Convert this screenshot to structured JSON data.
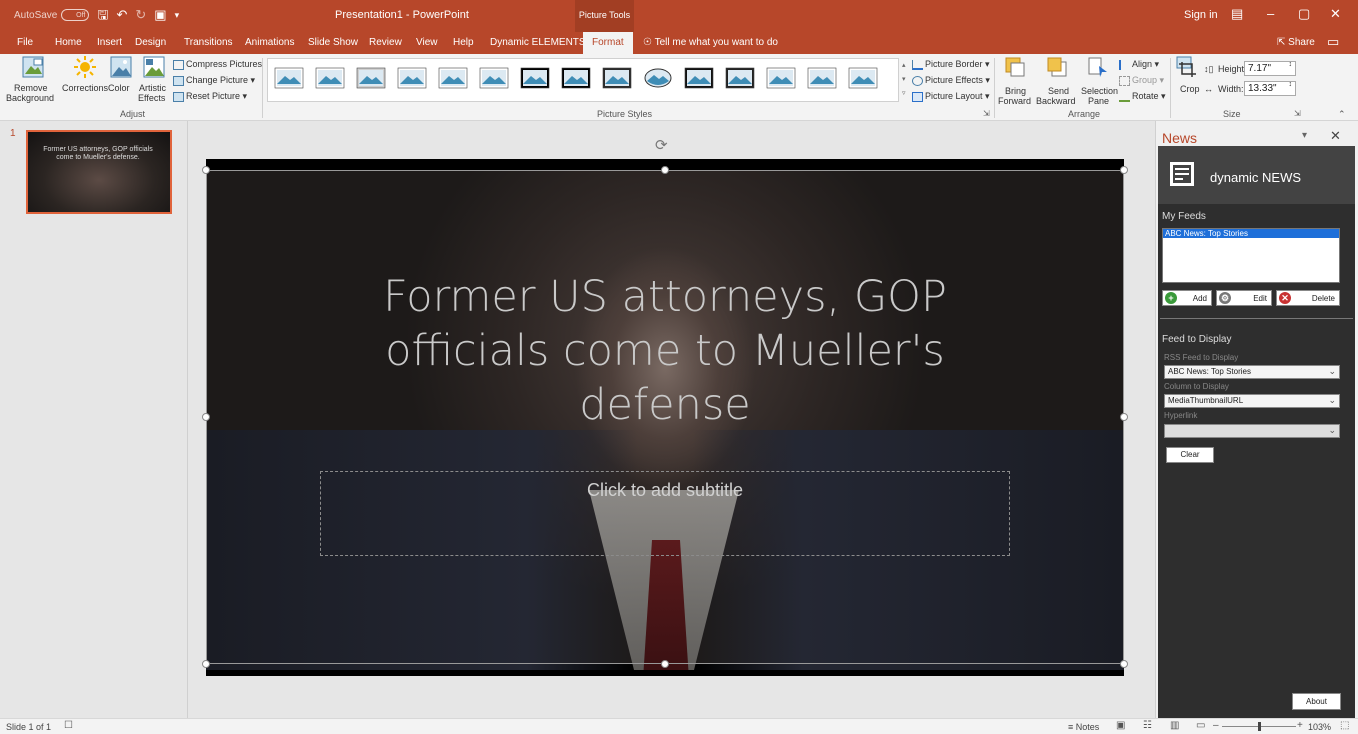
{
  "titlebar": {
    "autosave_label": "AutoSave",
    "autosave_state": "Off",
    "doc_title": "Presentation1 - PowerPoint",
    "context_group": "Picture Tools",
    "sign_in": "Sign in",
    "icons": [
      "save-icon",
      "undo-icon",
      "redo-icon",
      "present-from-start-icon",
      "customize-qat-icon",
      "ribbon-display-icon",
      "minimize-icon",
      "restore-icon",
      "close-icon"
    ]
  },
  "tabs": {
    "items": [
      "File",
      "Home",
      "Insert",
      "Design",
      "Transitions",
      "Animations",
      "Slide Show",
      "Review",
      "View",
      "Help",
      "Dynamic ELEMENTS",
      "Format"
    ],
    "active": "Format",
    "tell_me": "Tell me what you want to do",
    "share": "Share"
  },
  "ribbon": {
    "adjust": {
      "remove_background": [
        "Remove",
        "Background"
      ],
      "corrections": "Corrections",
      "color": "Color",
      "artistic_effects": [
        "Artistic",
        "Effects"
      ],
      "compress": "Compress Pictures",
      "change": "Change Picture",
      "reset": "Reset Picture",
      "group_label": "Adjust"
    },
    "picture_styles": {
      "count": 15,
      "border": "Picture Border",
      "effects": "Picture Effects",
      "layout": "Picture Layout",
      "group_label": "Picture Styles"
    },
    "arrange": {
      "bring_forward": [
        "Bring",
        "Forward"
      ],
      "send_backward": [
        "Send",
        "Backward"
      ],
      "selection_pane": [
        "Selection",
        "Pane"
      ],
      "align": "Align",
      "group": "Group",
      "rotate": "Rotate",
      "group_label": "Arrange"
    },
    "size": {
      "crop": "Crop",
      "height_label": "Height:",
      "height_value": "7.17\"",
      "width_label": "Width:",
      "width_value": "13.33\"",
      "group_label": "Size"
    }
  },
  "thumbnail": {
    "number": "1",
    "title": "Former US attorneys, GOP officials come to Mueller's defense."
  },
  "slide": {
    "title": "Former US attorneys, GOP officials come to Mueller's defense",
    "subtitle_placeholder": "Click to add subtitle"
  },
  "news_pane": {
    "title": "News",
    "brand": "dynamic NEWS",
    "my_feeds": "My Feeds",
    "feeds": [
      "ABC News: Top Stories"
    ],
    "add": "Add",
    "edit": "Edit",
    "delete": "Delete",
    "feed_to_display": "Feed to Display",
    "rss_label": "RSS Feed to Display",
    "rss_value": "ABC News: Top Stories",
    "column_label": "Column to Display",
    "column_value": "MediaThumbnailURL",
    "hyperlink_label": "Hyperlink",
    "hyperlink_value": "",
    "clear": "Clear",
    "about": "About"
  },
  "statusbar": {
    "slide_info": "Slide 1 of 1",
    "notes": "Notes",
    "zoom": "103%"
  }
}
